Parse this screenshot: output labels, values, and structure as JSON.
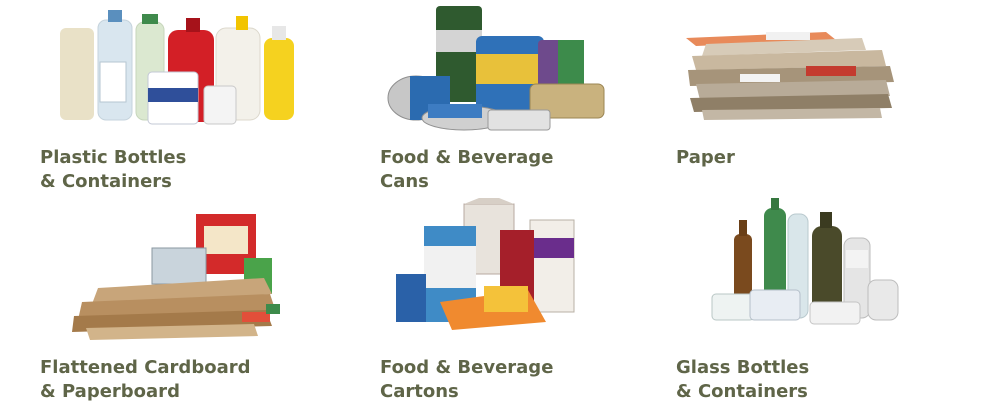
{
  "items": [
    {
      "icon": "plastic-bottles-image",
      "line1": "Plastic Bottles",
      "line2": "& Containers"
    },
    {
      "icon": "food-cans-image",
      "line1": "Food & Beverage",
      "line2": "Cans"
    },
    {
      "icon": "paper-stack-image",
      "line1": "Paper",
      "line2": ""
    },
    {
      "icon": "cardboard-stack-image",
      "line1": "Flattened Cardboard",
      "line2": "& Paperboard"
    },
    {
      "icon": "cartons-image",
      "line1": "Food & Beverage",
      "line2": "Cartons"
    },
    {
      "icon": "glass-bottles-image",
      "line1": "Glass Bottles",
      "line2": "& Containers"
    }
  ],
  "colors": {
    "label": "#5f6548"
  }
}
